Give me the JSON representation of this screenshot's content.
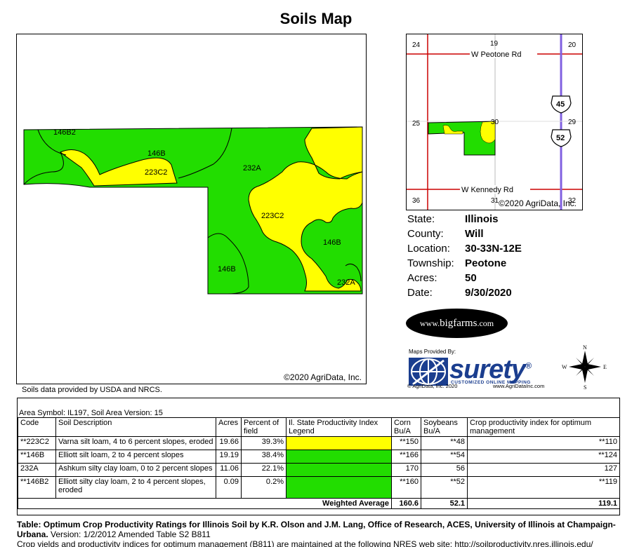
{
  "title": "Soils Map",
  "main_map": {
    "labels": [
      "146B2",
      "146B",
      "223C2",
      "232A",
      "223C2",
      "146B",
      "146B",
      "232A"
    ],
    "copyright": "©2020 AgriData, Inc.",
    "colors": {
      "green": "#22dd00",
      "yellow": "#ffff00"
    }
  },
  "soils_note": "Soils data provided by USDA and NRCS.",
  "location_map": {
    "section_numbers": [
      "24",
      "19",
      "20",
      "25",
      "30",
      "29",
      "36",
      "31",
      "32"
    ],
    "roads": [
      "W Peotone Rd",
      "W Kennedy Rd"
    ],
    "routes": [
      "45",
      "52"
    ],
    "copyright": "©2020 AgriData, Inc."
  },
  "info": [
    {
      "label": "State:",
      "value": "Illinois"
    },
    {
      "label": "County:",
      "value": "Will"
    },
    {
      "label": "Location:",
      "value": "30-33N-12E"
    },
    {
      "label": "Township:",
      "value": "Peotone"
    },
    {
      "label": "Acres:",
      "value": "50"
    },
    {
      "label": "Date:",
      "value": "9/30/2020"
    }
  ],
  "bigfarms": {
    "prefix": "www.",
    "brand": "bigfarms",
    "suffix": ".com"
  },
  "surety": {
    "provided_by": "Maps Provided By:",
    "name": "surety",
    "registered": "®",
    "tagline": "CUSTOMIZED ONLINE MAPPING",
    "footer_left": "© AgriData, Inc. 2020",
    "footer_right": "www.AgriDataInc.com"
  },
  "compass": {
    "n": "N",
    "s": "S",
    "e": "E",
    "w": "W"
  },
  "table": {
    "area_symbol": "Area Symbol: IL197, Soil Area Version: 15",
    "headers": [
      "Code",
      "Soil Description",
      "Acres",
      "Percent of field",
      "Il. State Productivity Index Legend",
      "Corn Bu/A",
      "Soybeans Bu/A",
      "Crop productivity index for optimum management"
    ],
    "rows": [
      {
        "code": "**223C2",
        "desc": "Varna silt loam, 4 to 6 percent slopes, eroded",
        "acres": "19.66",
        "pct": "39.3%",
        "color": "#ffff00",
        "corn": "**150",
        "soy": "**48",
        "cpi": "**110"
      },
      {
        "code": "**146B",
        "desc": "Elliott silt loam, 2 to 4 percent slopes",
        "acres": "19.19",
        "pct": "38.4%",
        "color": "#22dd00",
        "corn": "**166",
        "soy": "**54",
        "cpi": "**124"
      },
      {
        "code": "232A",
        "desc": "Ashkum silty clay loam, 0 to 2 percent slopes",
        "acres": "11.06",
        "pct": "22.1%",
        "color": "#22dd00",
        "corn": "170",
        "soy": "56",
        "cpi": "127"
      },
      {
        "code": "**146B2",
        "desc": "Elliott silty clay loam, 2 to 4 percent slopes, eroded",
        "acres": "0.09",
        "pct": "0.2%",
        "color": "#22dd00",
        "corn": "**160",
        "soy": "**52",
        "cpi": "**119"
      }
    ],
    "weighted": {
      "label": "Weighted Average",
      "corn": "160.6",
      "soy": "52.1",
      "cpi": "119.1"
    }
  },
  "footer": {
    "bold": "Table: Optimum Crop Productivity Ratings for Illinois Soil by K.R. Olson and J.M. Lang, Office of Research, ACES, University of Illinois at Champaign-Urbana.",
    "normal": " Version: 1/2/2012 Amended Table S2 B811",
    "line2": "Crop yields and productivity indices for optimum management (B811) are maintained at the following NRES web site: http://soilproductivity.nres.illinois.edu/"
  }
}
